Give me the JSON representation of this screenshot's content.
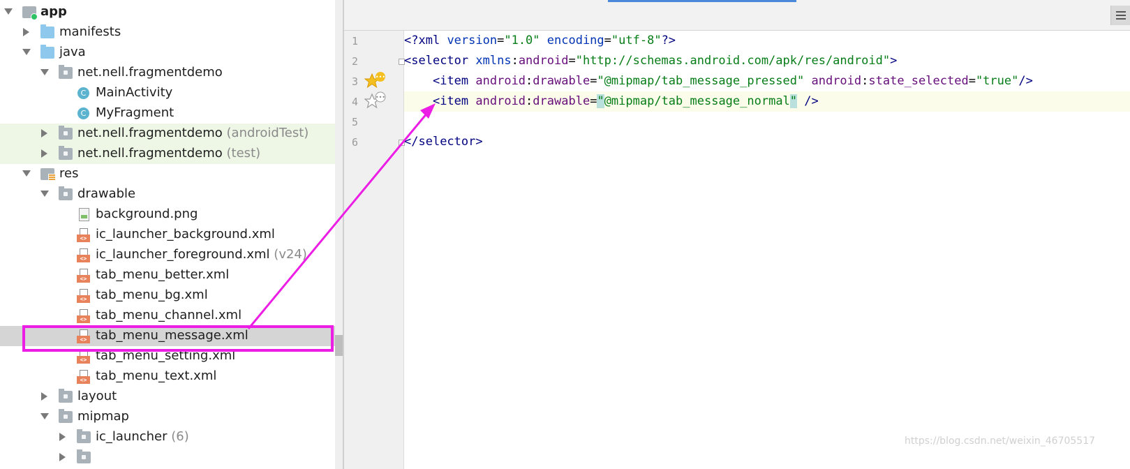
{
  "tree": {
    "items": [
      {
        "label": "app",
        "suffix": "",
        "icon": "module-icon",
        "expanded": true
      },
      {
        "label": "manifests",
        "suffix": "",
        "icon": "folder-icon",
        "expanded": false
      },
      {
        "label": "java",
        "suffix": "",
        "icon": "folder-icon",
        "expanded": true
      },
      {
        "label": "net.nell.fragmentdemo",
        "suffix": "",
        "icon": "package-icon",
        "expanded": true
      },
      {
        "label": "MainActivity",
        "suffix": "",
        "icon": "class-icon"
      },
      {
        "label": "MyFragment",
        "suffix": "",
        "icon": "class-icon"
      },
      {
        "label": "net.nell.fragmentdemo",
        "suffix": "(androidTest)",
        "icon": "package-icon",
        "expanded": false
      },
      {
        "label": "net.nell.fragmentdemo",
        "suffix": "(test)",
        "icon": "package-icon",
        "expanded": false
      },
      {
        "label": "res",
        "suffix": "",
        "icon": "res-folder-icon",
        "expanded": true
      },
      {
        "label": "drawable",
        "suffix": "",
        "icon": "folder-icon",
        "expanded": true
      },
      {
        "label": "background.png",
        "suffix": "",
        "icon": "image-file-icon"
      },
      {
        "label": "ic_launcher_background.xml",
        "suffix": "",
        "icon": "xml-file-icon"
      },
      {
        "label": "ic_launcher_foreground.xml",
        "suffix": "(v24)",
        "icon": "xml-file-icon"
      },
      {
        "label": "tab_menu_better.xml",
        "suffix": "",
        "icon": "xml-file-icon"
      },
      {
        "label": "tab_menu_bg.xml",
        "suffix": "",
        "icon": "xml-file-icon"
      },
      {
        "label": "tab_menu_channel.xml",
        "suffix": "",
        "icon": "xml-file-icon"
      },
      {
        "label": "tab_menu_message.xml",
        "suffix": "",
        "icon": "xml-file-icon",
        "selected": true
      },
      {
        "label": "tab_menu_setting.xml",
        "suffix": "",
        "icon": "xml-file-icon"
      },
      {
        "label": "tab_menu_text.xml",
        "suffix": "",
        "icon": "xml-file-icon"
      },
      {
        "label": "layout",
        "suffix": "",
        "icon": "folder-icon",
        "expanded": false
      },
      {
        "label": "mipmap",
        "suffix": "",
        "icon": "folder-icon",
        "expanded": true
      },
      {
        "label": "ic_launcher",
        "suffix": "(6)",
        "icon": "folder-icon",
        "expanded": false
      }
    ]
  },
  "editor": {
    "line_numbers": [
      "1",
      "2",
      "3",
      "4",
      "5",
      "6"
    ],
    "code": {
      "l1": {
        "open": "<?",
        "tag": "xml",
        "attr1": " version",
        "eq1": "=",
        "val1": "\"1.0\"",
        "attr2": " encoding",
        "eq2": "=",
        "val2": "\"utf-8\"",
        "close": "?>"
      },
      "l2": {
        "open": "<",
        "tag": "selector",
        "ns": " xmlns",
        "colon": ":",
        "attr": "android",
        "eq": "=",
        "val": "\"http://schemas.android.com/apk/res/android\"",
        "close": ">"
      },
      "l3": {
        "indent": "    ",
        "open": "<",
        "tag": "item",
        "ns1": " android",
        "c1": ":",
        "attr1": "drawable",
        "eq1": "=",
        "val1": "\"@mipmap/tab_message_pressed\"",
        "ns2": " android",
        "c2": ":",
        "attr2": "state_selected",
        "eq2": "=",
        "val2": "\"true\"",
        "close": "/>"
      },
      "l4": {
        "indent": "    ",
        "open": "<",
        "tag": "item",
        "ns1": " android",
        "c1": ":",
        "attr1": "drawable",
        "eq1": "=",
        "q1": "\"",
        "val1": "@mipmap/tab_message_normal",
        "q2": "\"",
        "close": " />"
      },
      "l6": {
        "open": "</",
        "tag": "selector",
        "close": ">"
      }
    }
  },
  "watermark": "https://blog.csdn.net/weixin_46705517",
  "colors": {
    "annotation": "#ec1ee6",
    "xml_tag": "#000080",
    "xml_attr": "#660e7a",
    "xml_value": "#067d17"
  }
}
